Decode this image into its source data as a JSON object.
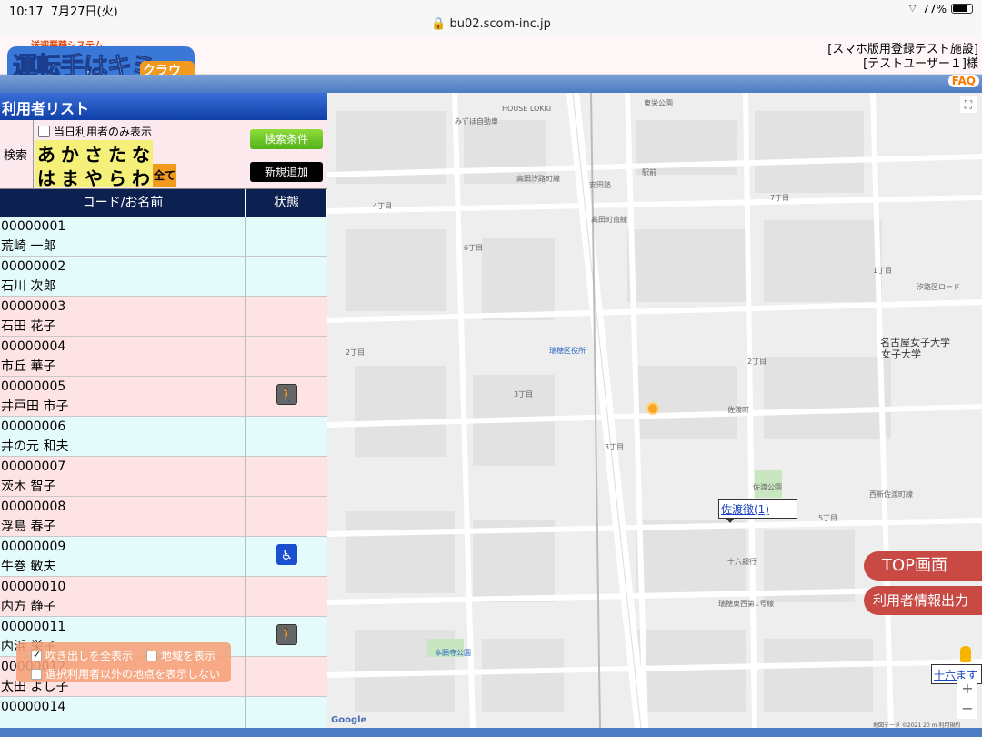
{
  "status_bar": {
    "time": "10:17",
    "date": "7月27日(火)",
    "url": "bu02.scom-inc.jp",
    "battery": "77%"
  },
  "header": {
    "logo_top": "送迎業務システム",
    "logo_main": "運転手はキミだ!!",
    "logo_sub": "クラウド",
    "facility": "[スマホ版用登録テスト施設]",
    "user": "[テストユーザー１]様",
    "faq": "FAQ"
  },
  "panel": {
    "title": "利用者リスト",
    "search_label": "検索",
    "today_only": "当日利用者のみ表示",
    "kana_row1": [
      "あ",
      "か",
      "さ",
      "た",
      "な"
    ],
    "kana_row2": [
      "は",
      "ま",
      "や",
      "ら",
      "わ"
    ],
    "kana_all": "全て",
    "search_button": "検索条件",
    "new_button": "新規追加",
    "col_name": "コード/お名前",
    "col_status": "状態"
  },
  "users": [
    {
      "code": "00000001",
      "name": "荒崎 一郎",
      "color": "cyan",
      "status": ""
    },
    {
      "code": "00000002",
      "name": "石川 次郎",
      "color": "cyan",
      "status": ""
    },
    {
      "code": "00000003",
      "name": "石田 花子",
      "color": "pink",
      "status": ""
    },
    {
      "code": "00000004",
      "name": "市丘 華子",
      "color": "pink",
      "status": ""
    },
    {
      "code": "00000005",
      "name": "井戸田 市子",
      "color": "pink",
      "status": "walker"
    },
    {
      "code": "00000006",
      "name": "井の元 和夫",
      "color": "cyan",
      "status": ""
    },
    {
      "code": "00000007",
      "name": "茨木 智子",
      "color": "pink",
      "status": ""
    },
    {
      "code": "00000008",
      "name": "浮島 春子",
      "color": "pink",
      "status": ""
    },
    {
      "code": "00000009",
      "name": "牛巻 敏夫",
      "color": "cyan",
      "status": "wheelchair"
    },
    {
      "code": "00000010",
      "name": "内方 静子",
      "color": "pink",
      "status": ""
    },
    {
      "code": "00000011",
      "name": "内浜 栄子",
      "color": "cyan",
      "status": "walker"
    },
    {
      "code": "00000012",
      "name": "太田 よし子",
      "color": "pink",
      "status": ""
    },
    {
      "code": "00000014",
      "name": "",
      "color": "cyan",
      "status": ""
    }
  ],
  "overlay": {
    "show_all_balloons": "吹き出しを全表示",
    "show_area": "地域を表示",
    "hide_other": "選択利用者以外の地点を表示しない"
  },
  "map": {
    "marker_label": "佐渡徹(1)",
    "second_marker": "十六ます",
    "top_button": "TOP画面",
    "export_button": "利用者情報出力",
    "google": "Google",
    "footer": "地図データ ©2021  20 m  利用規約",
    "labels": {
      "houselokki": "HOUSE LOKKI",
      "east_park": "東栄公園",
      "mizuho_store": "みずほ自動車",
      "takata_line": "高田汐路町線",
      "yasuda": "安田塾",
      "takata_cho": "高田町南線",
      "ekimae": "駅前",
      "nagoya_univ": "名古屋女子大学",
      "mizuho_ward": "瑞穂区役所",
      "sado": "佐渡町",
      "sado_park": "佐渡公園",
      "nishi_sado": "西新佐渡町線",
      "juroku": "十六銀行",
      "mizuho_east": "瑞穂東西第1号線",
      "honden": "本願寺公園",
      "chome1": "1丁目",
      "chome2": "2丁目",
      "chome3": "3丁目",
      "chome4": "4丁目",
      "chome5": "5丁目",
      "chome6": "6丁目",
      "chome7": "7丁目",
      "university": "女子大学",
      "shiodi": "汐路区ロード"
    }
  }
}
